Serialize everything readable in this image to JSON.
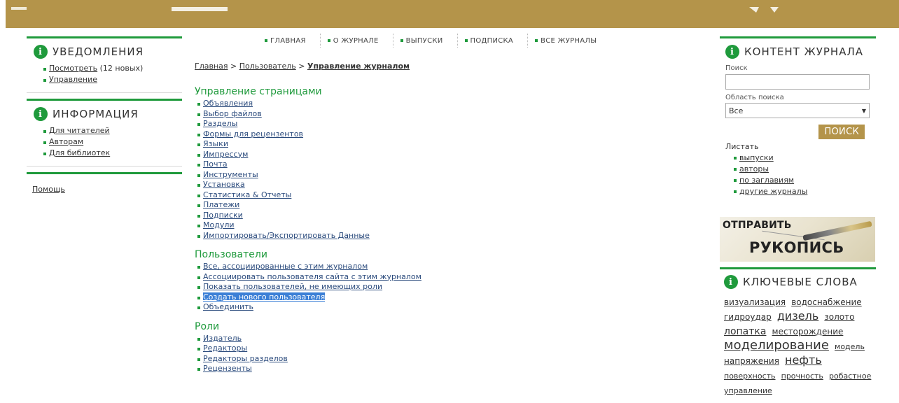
{
  "colors": {
    "brand_gold": "#b4944a",
    "accent_green": "#1f9a3c",
    "selection_blue": "#3b7fd6"
  },
  "left": {
    "notifications": {
      "title": "УВЕДОМЛЕНИЯ",
      "items": [
        {
          "label": "Посмотреть",
          "suffix": " (12 новых)"
        },
        {
          "label": "Управление"
        }
      ]
    },
    "information": {
      "title": "ИНФОРМАЦИЯ",
      "items": [
        {
          "label": "Для читателей"
        },
        {
          "label": "Авторам"
        },
        {
          "label": "Для библиотек"
        }
      ]
    },
    "help": {
      "label": "Помощь"
    }
  },
  "nav": {
    "items": [
      "ГЛАВНАЯ",
      "О ЖУРНАЛЕ",
      "ВЫПУСКИ",
      "ПОДПИСКА",
      "ВСЕ ЖУРНАЛЫ"
    ]
  },
  "breadcrumb": {
    "home": "Главная",
    "sep1": " > ",
    "user": "Пользователь",
    "sep2": " > ",
    "current": "Управление журналом"
  },
  "sections": {
    "pages": {
      "title": "Управление страницами",
      "items": [
        "Объявления",
        "Выбор файлов",
        "Разделы",
        "Формы для рецензентов",
        "Языки",
        "Импрессум",
        "Почта",
        "Инструменты",
        "Установка",
        "Статистика & Отчеты",
        "Платежи",
        "Подписки",
        "Модули",
        "Импортировать/Экспортировать Данные"
      ]
    },
    "users": {
      "title": "Пользователи",
      "items": [
        "Все, ассоциированные с этим журналом",
        "Ассоциировать пользователя сайта с этим журналом",
        "Показать пользователей, не имеющих роли",
        "Создать нового пользователя",
        "Объединить"
      ]
    },
    "roles": {
      "title": "Роли",
      "items": [
        "Издатель",
        "Редакторы",
        "Редакторы разделов",
        "Рецензенты"
      ]
    }
  },
  "right": {
    "content": {
      "title": "КОНТЕНТ ЖУРНАЛА",
      "search_label": "Поиск",
      "search_value": "",
      "scope_label": "Область поиска",
      "scope_value": "Все",
      "search_button": "ПОИСК",
      "browse_label": "Листать",
      "browse_items": [
        "выпуски",
        "авторы",
        "по заглавиям",
        "другие журналы"
      ]
    },
    "submit": {
      "line1": "ОТПРАВИТЬ",
      "line2": "РУКОПИСЬ"
    },
    "keywords": {
      "title": "КЛЮЧЕВЫЕ СЛОВА",
      "words": [
        {
          "text": "визуализация",
          "size": "m"
        },
        {
          "text": "водоснабжение",
          "size": "m"
        },
        {
          "text": "гидроудар",
          "size": "m"
        },
        {
          "text": "дизель",
          "size": "xl"
        },
        {
          "text": "золото",
          "size": "m"
        },
        {
          "text": "лопатка",
          "size": "l"
        },
        {
          "text": "месторождение",
          "size": "m"
        },
        {
          "text": "моделирование",
          "size": "xxl"
        },
        {
          "text": "модель",
          "size": "s"
        },
        {
          "text": "напряжения",
          "size": "m"
        },
        {
          "text": "нефть",
          "size": "xl"
        },
        {
          "text": "поверхность",
          "size": "s"
        },
        {
          "text": "прочность",
          "size": "s"
        },
        {
          "text": "робастное управление",
          "size": "s"
        }
      ]
    }
  }
}
